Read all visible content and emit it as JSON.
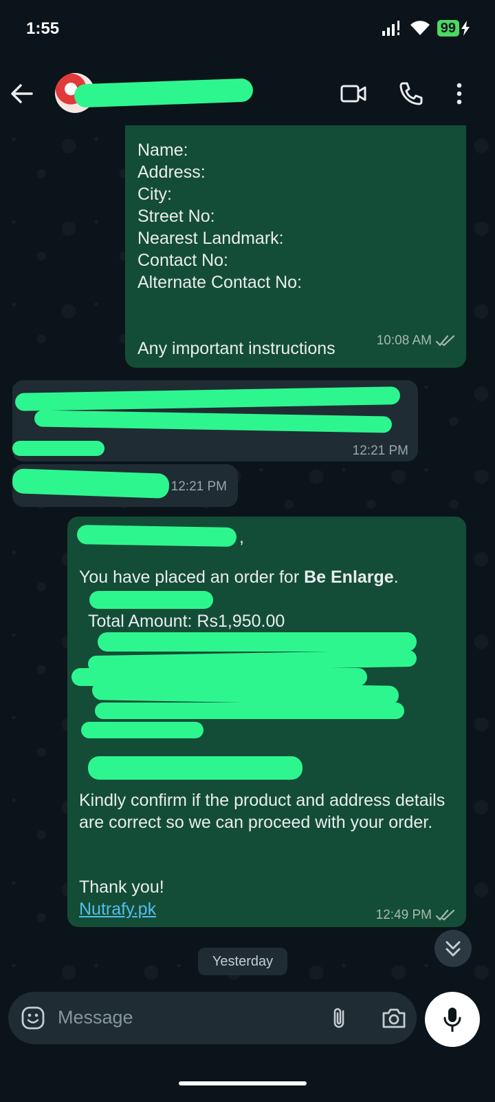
{
  "status_bar": {
    "time": "1:55",
    "battery": "99"
  },
  "header": {
    "contact_name": ""
  },
  "messages": [
    {
      "type": "outgoing",
      "lines": [
        "Name:",
        "Address:",
        "City:",
        "Street No:",
        "Nearest Landmark:",
        "Contact No:",
        "Alternate Contact No:",
        "",
        "",
        "Any important instructions"
      ],
      "time": "10:08 AM",
      "read": true
    },
    {
      "type": "incoming",
      "time": "12:21 PM"
    },
    {
      "type": "incoming",
      "time": "12:21 PM"
    },
    {
      "type": "outgoing",
      "greeting_suffix": ",",
      "order_intro": "You have placed an order for ",
      "product": "Be Enlarge",
      "period": ".",
      "total_amount": "Total Amount: Rs1,950.00",
      "confirm_text": "Kindly confirm if the product and address details are correct so we can proceed with your order.",
      "thanks": "Thank you!",
      "link": "Nutrafy.pk",
      "time": "12:49 PM",
      "read": true
    }
  ],
  "date_chip": "Yesterday",
  "composer": {
    "placeholder": "Message"
  },
  "icons": [
    "back-arrow-icon",
    "video-call-icon",
    "phone-icon",
    "more-options-icon",
    "emoji-icon",
    "attach-icon",
    "camera-icon",
    "mic-icon",
    "double-check-icon",
    "chevron-double-down-icon"
  ],
  "colors": {
    "outgoing_bubble": "#144d37",
    "incoming_bubble": "#202c33",
    "background": "#0b141a",
    "accent": "#2ef68f"
  }
}
